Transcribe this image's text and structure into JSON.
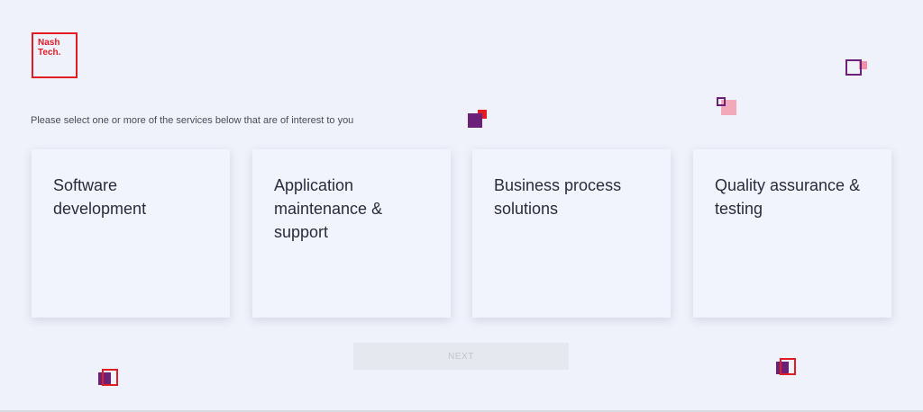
{
  "logo": {
    "line1": "Nash",
    "line2": "Tech."
  },
  "prompt": "Please select one or more of the services below that are of interest to you",
  "services": [
    {
      "label": "Software development"
    },
    {
      "label": "Application maintenance & support"
    },
    {
      "label": "Business process solutions"
    },
    {
      "label": "Quality assurance & testing"
    }
  ],
  "next_label": "NEXT",
  "colors": {
    "brand_red": "#e31b23",
    "purple": "#6b2178",
    "pink": "#ef8fa8",
    "background": "#eff2fb"
  }
}
